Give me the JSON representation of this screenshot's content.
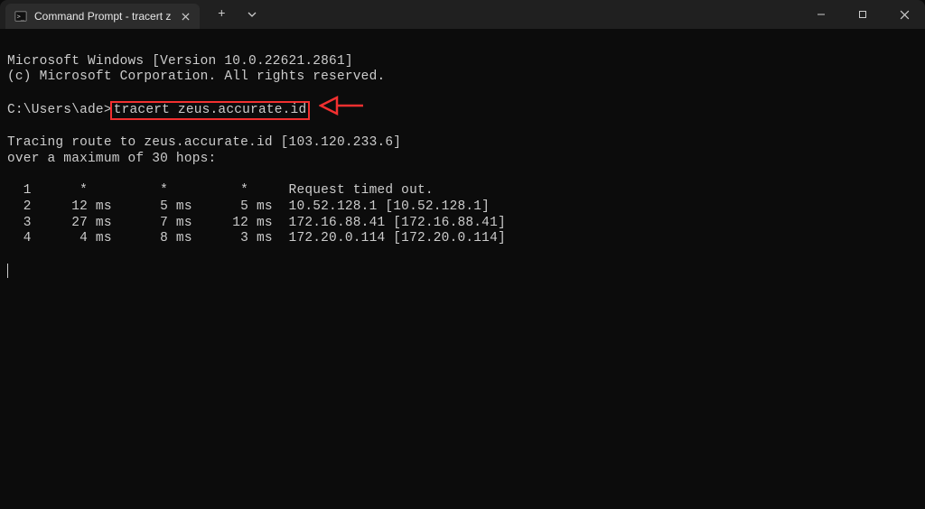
{
  "window": {
    "tab_title": "Command Prompt - tracert  z",
    "new_tab_label": "+",
    "dropdown_label": "▾"
  },
  "terminal": {
    "line_version": "Microsoft Windows [Version 10.0.22621.2861]",
    "line_copyright": "(c) Microsoft Corporation. All rights reserved.",
    "prompt_prefix": "C:\\Users\\ade>",
    "command": "tracert zeus.accurate.id",
    "trace_header": "Tracing route to zeus.accurate.id [103.120.233.6]",
    "trace_subheader": "over a maximum of 30 hops:",
    "hops": [
      {
        "n": "1",
        "t1": "*",
        "t2": "*",
        "t3": "*",
        "result": "Request timed out."
      },
      {
        "n": "2",
        "t1": "12 ms",
        "t2": "5 ms",
        "t3": "5 ms",
        "result": "10.52.128.1 [10.52.128.1]"
      },
      {
        "n": "3",
        "t1": "27 ms",
        "t2": "7 ms",
        "t3": "12 ms",
        "result": "172.16.88.41 [172.16.88.41]"
      },
      {
        "n": "4",
        "t1": "4 ms",
        "t2": "8 ms",
        "t3": "3 ms",
        "result": "172.20.0.114 [172.20.0.114]"
      }
    ]
  },
  "colors": {
    "annotation_red": "#f23030"
  }
}
